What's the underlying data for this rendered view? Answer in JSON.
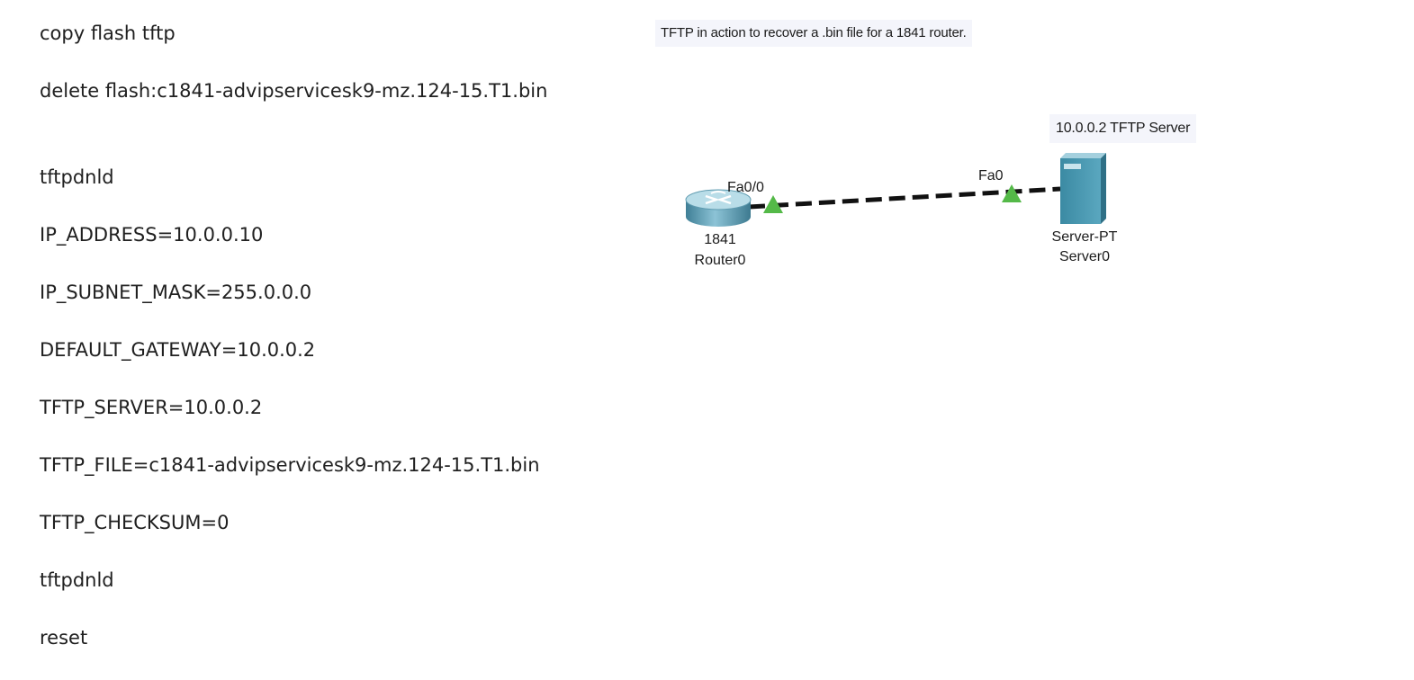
{
  "commands": [
    "copy flash tftp",
    "delete flash:c1841-advipservicesk9-mz.124-15.T1.bin",
    "tftpdnld",
    "IP_ADDRESS=10.0.0.10",
    "IP_SUBNET_MASK=255.0.0.0",
    "DEFAULT_GATEWAY=10.0.0.2",
    "TFTP_SERVER=10.0.0.2",
    "TFTP_FILE=c1841-advipservicesk9-mz.124-15.T1.bin",
    "TFTP_CHECKSUM=0",
    "tftpdnld",
    "reset"
  ],
  "topology": {
    "title_note": "TFTP in action to recover a .bin file for a 1841 router.",
    "server_note": "10.0.0.2  TFTP Server",
    "router": {
      "model": "1841",
      "name": "Router0",
      "port": "Fa0/0",
      "icon": "router-icon"
    },
    "server": {
      "model": "Server-PT",
      "name": "Server0",
      "port": "Fa0",
      "icon": "server-icon"
    },
    "link": {
      "style": "dashed-black",
      "status_color": "#54b948",
      "status": "up"
    }
  }
}
